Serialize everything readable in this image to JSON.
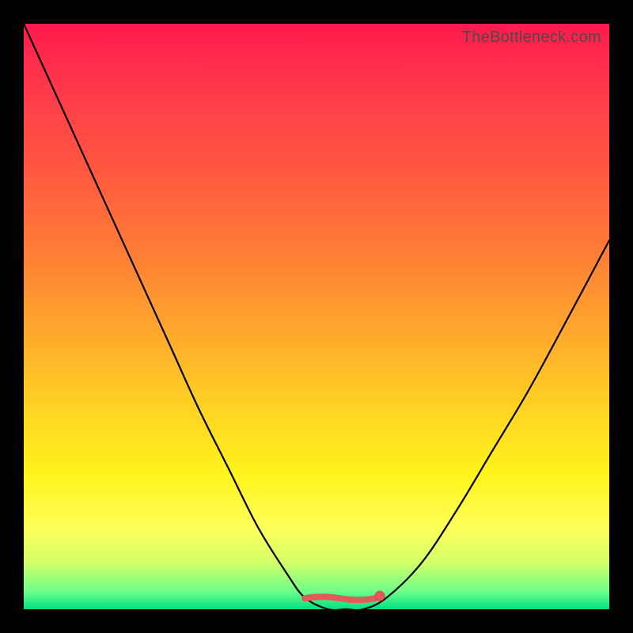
{
  "watermark": "TheBottleneck.com",
  "colors": {
    "frame": "#000000",
    "curve": "#000000",
    "marker": "#e35a5a",
    "marker_stroke": "#d04444"
  },
  "chart_data": {
    "type": "line",
    "title": "",
    "xlabel": "",
    "ylabel": "",
    "xlim": [
      0,
      100
    ],
    "ylim": [
      0,
      100
    ],
    "grid": false,
    "legend": false,
    "series": [
      {
        "name": "bottleneck-percent",
        "x": [
          0,
          5,
          10,
          15,
          20,
          25,
          30,
          35,
          40,
          45,
          48,
          52,
          55,
          58,
          62,
          68,
          74,
          80,
          86,
          92,
          100
        ],
        "y": [
          100,
          89,
          78,
          67,
          56,
          45,
          34,
          24,
          14,
          6,
          2,
          0,
          0,
          0,
          2,
          8,
          17,
          27,
          37,
          48,
          63
        ]
      }
    ],
    "annotations": [
      {
        "type": "flat-zone-marker",
        "x_start": 48,
        "x_end": 60,
        "y": 2
      }
    ]
  }
}
